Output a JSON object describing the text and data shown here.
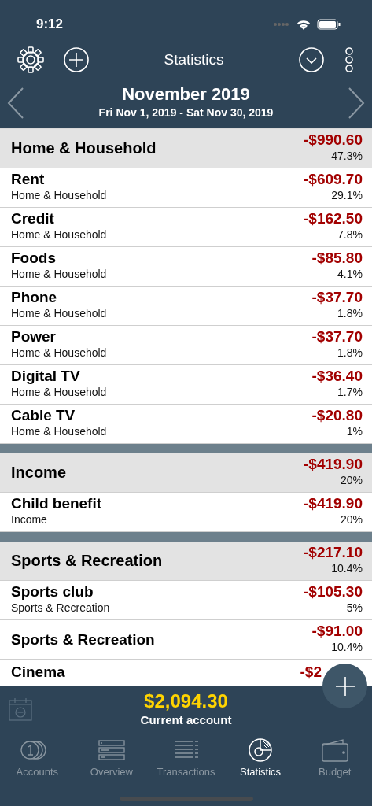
{
  "status_bar": {
    "time": "9:12"
  },
  "toolbar": {
    "title": "Statistics"
  },
  "period": {
    "title": "November 2019",
    "range": "Fri Nov 1, 2019 - Sat Nov 30, 2019"
  },
  "groups": [
    {
      "name": "Home & Household",
      "amount": "-$990.60",
      "percent": "47.3%",
      "items": [
        {
          "name": "Rent",
          "category": "Home & Household",
          "amount": "-$609.70",
          "percent": "29.1%"
        },
        {
          "name": "Credit",
          "category": "Home & Household",
          "amount": "-$162.50",
          "percent": "7.8%"
        },
        {
          "name": "Foods",
          "category": "Home & Household",
          "amount": "-$85.80",
          "percent": "4.1%"
        },
        {
          "name": "Phone",
          "category": "Home & Household",
          "amount": "-$37.70",
          "percent": "1.8%"
        },
        {
          "name": "Power",
          "category": "Home & Household",
          "amount": "-$37.70",
          "percent": "1.8%"
        },
        {
          "name": "Digital TV",
          "category": "Home & Household",
          "amount": "-$36.40",
          "percent": "1.7%"
        },
        {
          "name": "Cable TV",
          "category": "Home & Household",
          "amount": "-$20.80",
          "percent": "1%"
        }
      ]
    },
    {
      "name": "Income",
      "amount": "-$419.90",
      "percent": "20%",
      "items": [
        {
          "name": "Child benefit",
          "category": "Income",
          "amount": "-$419.90",
          "percent": "20%"
        }
      ]
    },
    {
      "name": "Sports & Recreation",
      "amount": "-$217.10",
      "percent": "10.4%",
      "items": [
        {
          "name": "Sports club",
          "category": "Sports & Recreation",
          "amount": "-$105.30",
          "percent": "5%"
        },
        {
          "name": "Sports & Recreation",
          "amount": "-$91.00",
          "percent": "10.4%"
        },
        {
          "name": "Cinema",
          "amount": "-$2"
        }
      ]
    }
  ],
  "summary": {
    "amount": "$2,094.30",
    "account": "Current account"
  },
  "tabs": [
    {
      "label": "Accounts",
      "selected": false
    },
    {
      "label": "Overview",
      "selected": false
    },
    {
      "label": "Transactions",
      "selected": false
    },
    {
      "label": "Statistics",
      "selected": true
    },
    {
      "label": "Budget",
      "selected": false
    }
  ]
}
